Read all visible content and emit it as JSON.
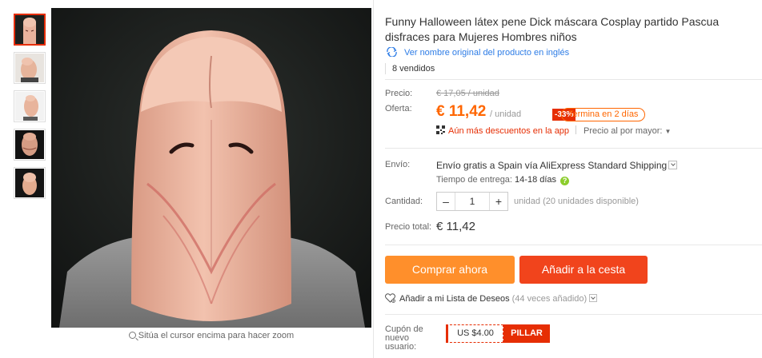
{
  "gallery": {
    "thumbnail_count": 5,
    "zoom_hint": "Sitúa el cursor encima para hacer zoom"
  },
  "product": {
    "title": "Funny Halloween látex pene Dick máscara Cosplay partido Pascua disfraces para Mujeres Hombres niños",
    "original_name_link": "Ver nombre original del producto en inglés",
    "sold": "8 vendidos"
  },
  "pricing": {
    "price_label": "Precio:",
    "original_price": "€ 17,05 / unidad",
    "offer_label": "Oferta:",
    "offer_price": "€ 11,42",
    "per_unit": "/ unidad",
    "discount": "-33%",
    "countdown": "Termina en 2 días",
    "app_discount": "Aún más descuentos en la app",
    "wholesale": "Precio al por mayor:"
  },
  "shipping": {
    "label": "Envío:",
    "method": "Envío gratis a Spain vía AliExpress Standard Shipping",
    "delivery_label": "Tiempo de entrega:",
    "delivery_time": "14-18 días"
  },
  "quantity": {
    "label": "Cantidad:",
    "minus": "–",
    "value": "1",
    "plus": "+",
    "available": "unidad (20 unidades disponible)"
  },
  "total": {
    "label": "Precio total:",
    "value": "€ 11,42"
  },
  "actions": {
    "buy_now": "Comprar ahora",
    "add_to_cart": "Añadir a la cesta",
    "wishlist": "Añadir a mi Lista de Deseos",
    "wishlist_count": "(44 veces añadido)"
  },
  "coupon": {
    "label": "Cupón de nuevo usuario:",
    "amount": "US $4.00",
    "get": "PILLAR"
  },
  "colors": {
    "accent_orange": "#ff6600",
    "buy_button": "#ff8f2b",
    "cart_button": "#f1441c",
    "link_blue": "#2d7ce6",
    "discount_red": "#e62e04"
  }
}
